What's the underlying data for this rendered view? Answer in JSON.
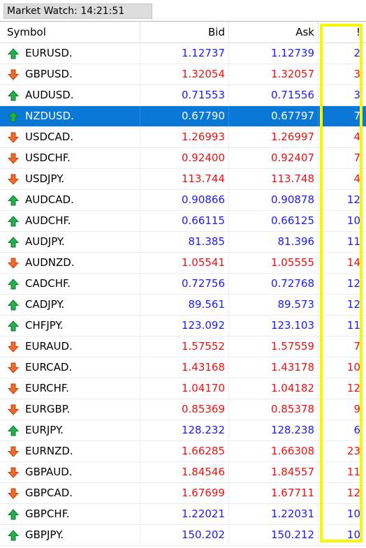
{
  "window": {
    "title": "Market Watch: 14:21:51"
  },
  "columns": {
    "symbol": "Symbol",
    "bid": "Bid",
    "ask": "Ask",
    "spread": "!"
  },
  "colors": {
    "up": "#1a1aff",
    "down": "#f01010",
    "selected_bg": "#0a78d7",
    "highlight": "#f7f700"
  },
  "icons": {
    "up": "green-up-arrow-icon",
    "down": "orange-down-arrow-icon"
  },
  "selected_symbol": "NZDUSD.",
  "rows": [
    {
      "symbol": "EURUSD.",
      "bid": "1.12737",
      "ask": "1.12739",
      "spread": "2",
      "direction": "up"
    },
    {
      "symbol": "GBPUSD.",
      "bid": "1.32054",
      "ask": "1.32057",
      "spread": "3",
      "direction": "down"
    },
    {
      "symbol": "AUDUSD.",
      "bid": "0.71553",
      "ask": "0.71556",
      "spread": "3",
      "direction": "up"
    },
    {
      "symbol": "NZDUSD.",
      "bid": "0.67790",
      "ask": "0.67797",
      "spread": "7",
      "direction": "up"
    },
    {
      "symbol": "USDCAD.",
      "bid": "1.26993",
      "ask": "1.26997",
      "spread": "4",
      "direction": "down"
    },
    {
      "symbol": "USDCHF.",
      "bid": "0.92400",
      "ask": "0.92407",
      "spread": "7",
      "direction": "down"
    },
    {
      "symbol": "USDJPY.",
      "bid": "113.744",
      "ask": "113.748",
      "spread": "4",
      "direction": "down"
    },
    {
      "symbol": "AUDCAD.",
      "bid": "0.90866",
      "ask": "0.90878",
      "spread": "12",
      "direction": "up"
    },
    {
      "symbol": "AUDCHF.",
      "bid": "0.66115",
      "ask": "0.66125",
      "spread": "10",
      "direction": "up"
    },
    {
      "symbol": "AUDJPY.",
      "bid": "81.385",
      "ask": "81.396",
      "spread": "11",
      "direction": "up"
    },
    {
      "symbol": "AUDNZD.",
      "bid": "1.05541",
      "ask": "1.05555",
      "spread": "14",
      "direction": "down"
    },
    {
      "symbol": "CADCHF.",
      "bid": "0.72756",
      "ask": "0.72768",
      "spread": "12",
      "direction": "up"
    },
    {
      "symbol": "CADJPY.",
      "bid": "89.561",
      "ask": "89.573",
      "spread": "12",
      "direction": "up"
    },
    {
      "symbol": "CHFJPY.",
      "bid": "123.092",
      "ask": "123.103",
      "spread": "11",
      "direction": "up"
    },
    {
      "symbol": "EURAUD.",
      "bid": "1.57552",
      "ask": "1.57559",
      "spread": "7",
      "direction": "down"
    },
    {
      "symbol": "EURCAD.",
      "bid": "1.43168",
      "ask": "1.43178",
      "spread": "10",
      "direction": "down"
    },
    {
      "symbol": "EURCHF.",
      "bid": "1.04170",
      "ask": "1.04182",
      "spread": "12",
      "direction": "down"
    },
    {
      "symbol": "EURGBP.",
      "bid": "0.85369",
      "ask": "0.85378",
      "spread": "9",
      "direction": "down"
    },
    {
      "symbol": "EURJPY.",
      "bid": "128.232",
      "ask": "128.238",
      "spread": "6",
      "direction": "up"
    },
    {
      "symbol": "EURNZD.",
      "bid": "1.66285",
      "ask": "1.66308",
      "spread": "23",
      "direction": "down"
    },
    {
      "symbol": "GBPAUD.",
      "bid": "1.84546",
      "ask": "1.84557",
      "spread": "11",
      "direction": "down"
    },
    {
      "symbol": "GBPCAD.",
      "bid": "1.67699",
      "ask": "1.67711",
      "spread": "12",
      "direction": "down"
    },
    {
      "symbol": "GBPCHF.",
      "bid": "1.22021",
      "ask": "1.22031",
      "spread": "10",
      "direction": "up"
    },
    {
      "symbol": "GBPJPY.",
      "bid": "150.202",
      "ask": "150.212",
      "spread": "10",
      "direction": "up"
    }
  ]
}
